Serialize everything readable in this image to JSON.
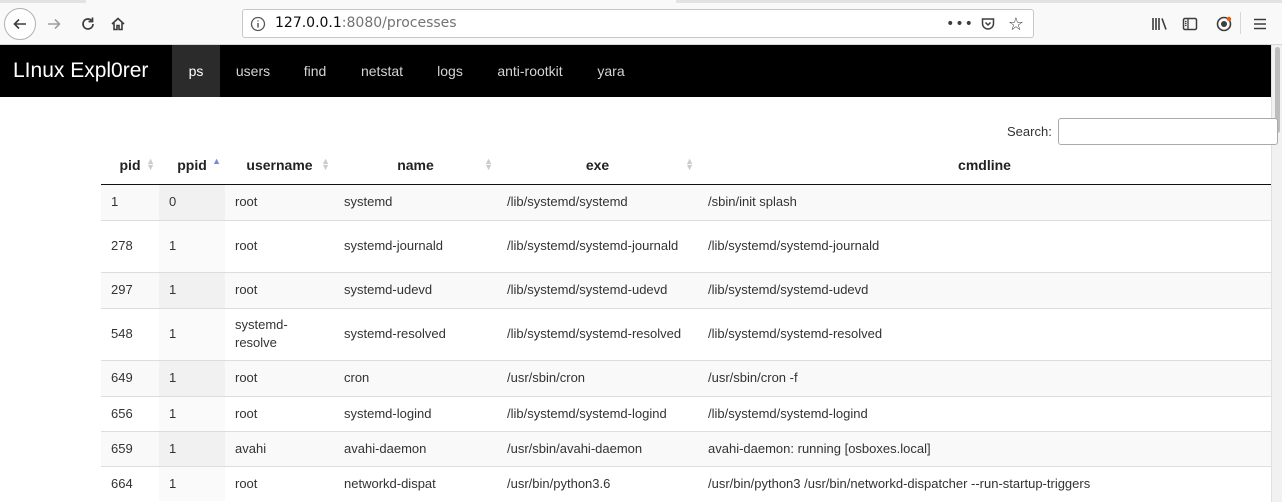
{
  "browser": {
    "url_host": "127.0.0.1",
    "url_rest": ":8080/processes",
    "icons": {
      "back": "back-arrow-icon",
      "forward": "forward-arrow-icon",
      "reload": "reload-icon",
      "home": "home-icon",
      "info": "info-icon",
      "more": "more-actions-icon",
      "pocket": "pocket-icon",
      "bookmark": "star-icon",
      "library": "library-icon",
      "sidebar": "sidebar-icon",
      "account": "account-icon",
      "menu": "hamburger-menu-icon"
    }
  },
  "app": {
    "brand": "LInux Expl0rer",
    "nav": [
      {
        "label": "ps",
        "active": true
      },
      {
        "label": "users",
        "active": false
      },
      {
        "label": "find",
        "active": false
      },
      {
        "label": "netstat",
        "active": false
      },
      {
        "label": "logs",
        "active": false
      },
      {
        "label": "anti-rootkit",
        "active": false
      },
      {
        "label": "yara",
        "active": false
      }
    ]
  },
  "search": {
    "label": "Search:",
    "value": ""
  },
  "table": {
    "columns": [
      "pid",
      "ppid",
      "username",
      "name",
      "exe",
      "cmdline"
    ],
    "sorted_column": "ppid",
    "rows": [
      [
        "1",
        "0",
        "root",
        "systemd",
        "/lib/systemd/systemd",
        "/sbin/init splash"
      ],
      [
        "278",
        "1",
        "root",
        "systemd-journald",
        "/lib/systemd/systemd-journald",
        "/lib/systemd/systemd-journald"
      ],
      [
        "297",
        "1",
        "root",
        "systemd-udevd",
        "/lib/systemd/systemd-udevd",
        "/lib/systemd/systemd-udevd"
      ],
      [
        "548",
        "1",
        "systemd-resolve",
        "systemd-resolved",
        "/lib/systemd/systemd-resolved",
        "/lib/systemd/systemd-resolved"
      ],
      [
        "649",
        "1",
        "root",
        "cron",
        "/usr/sbin/cron",
        "/usr/sbin/cron -f"
      ],
      [
        "656",
        "1",
        "root",
        "systemd-logind",
        "/lib/systemd/systemd-logind",
        "/lib/systemd/systemd-logind"
      ],
      [
        "659",
        "1",
        "avahi",
        "avahi-daemon",
        "/usr/sbin/avahi-daemon",
        "avahi-daemon: running [osboxes.local]"
      ],
      [
        "664",
        "1",
        "root",
        "networkd-dispat",
        "/usr/bin/python3.6",
        "/usr/bin/python3 /usr/bin/networkd-dispatcher --run-startup-triggers"
      ]
    ]
  }
}
